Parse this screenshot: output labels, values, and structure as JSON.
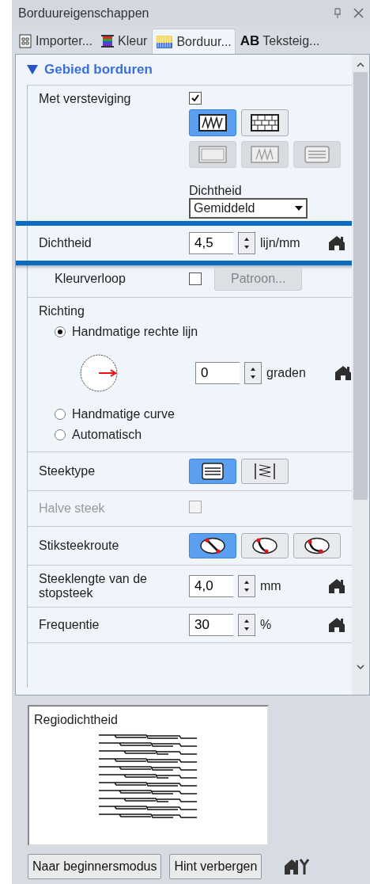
{
  "window": {
    "title": "Borduureigenschappen"
  },
  "tabs": [
    {
      "label": "Importer...",
      "selected": false
    },
    {
      "label": "Kleur",
      "selected": false
    },
    {
      "label": "Borduur...",
      "selected": true
    },
    {
      "label": "Teksteig...",
      "badge": "AB",
      "selected": false
    }
  ],
  "section": {
    "title": "Gebied borduren",
    "expanded": true
  },
  "rows": [
    {
      "kind": "reinforcement",
      "label": "Met versteviging",
      "checked": true,
      "button_rows": [
        [
          {
            "selected": true,
            "disabled": false
          },
          {
            "selected": false,
            "disabled": false
          }
        ],
        [
          {
            "selected": false,
            "disabled": true
          },
          {
            "selected": false,
            "disabled": true
          },
          {
            "selected": false,
            "disabled": true
          }
        ]
      ],
      "sub_label": "Dichtheid",
      "dropdown": "Gemiddeld"
    },
    {
      "kind": "spin",
      "label": "Dichtheid",
      "value": "4,5",
      "unit": "lijn/mm",
      "highlighted": true
    },
    {
      "kind": "check_button",
      "label": "Kleurverloop",
      "checked": false,
      "button": "Patroon...",
      "button_disabled": true
    },
    {
      "kind": "direction",
      "label": "Richting",
      "options": [
        {
          "label": "Handmatige rechte lijn",
          "selected": true
        },
        {
          "label": "Handmatige curve",
          "selected": false
        },
        {
          "label": "Automatisch",
          "selected": false
        }
      ],
      "value": "0",
      "unit": "graden"
    },
    {
      "kind": "stitch_type",
      "label": "Steektype",
      "buttons": [
        {
          "selected": true
        },
        {
          "selected": false
        }
      ]
    },
    {
      "kind": "check",
      "label": "Halve steek",
      "checked": false,
      "disabled": true
    },
    {
      "kind": "route",
      "label": "Stiksteekroute",
      "buttons": [
        {
          "selected": true
        },
        {
          "selected": false
        },
        {
          "selected": false
        }
      ]
    },
    {
      "kind": "spin",
      "label": "Steeklengte van de stopsteek",
      "value": "4,0",
      "unit": "mm"
    },
    {
      "kind": "spin",
      "label": "Frequentie",
      "value": "30",
      "unit": "%"
    },
    {
      "kind": "partial"
    }
  ],
  "hint": {
    "title": "Regiodichtheid"
  },
  "footer": {
    "buttons": [
      "Naar beginnersmodus",
      "Hint verbergen"
    ]
  }
}
